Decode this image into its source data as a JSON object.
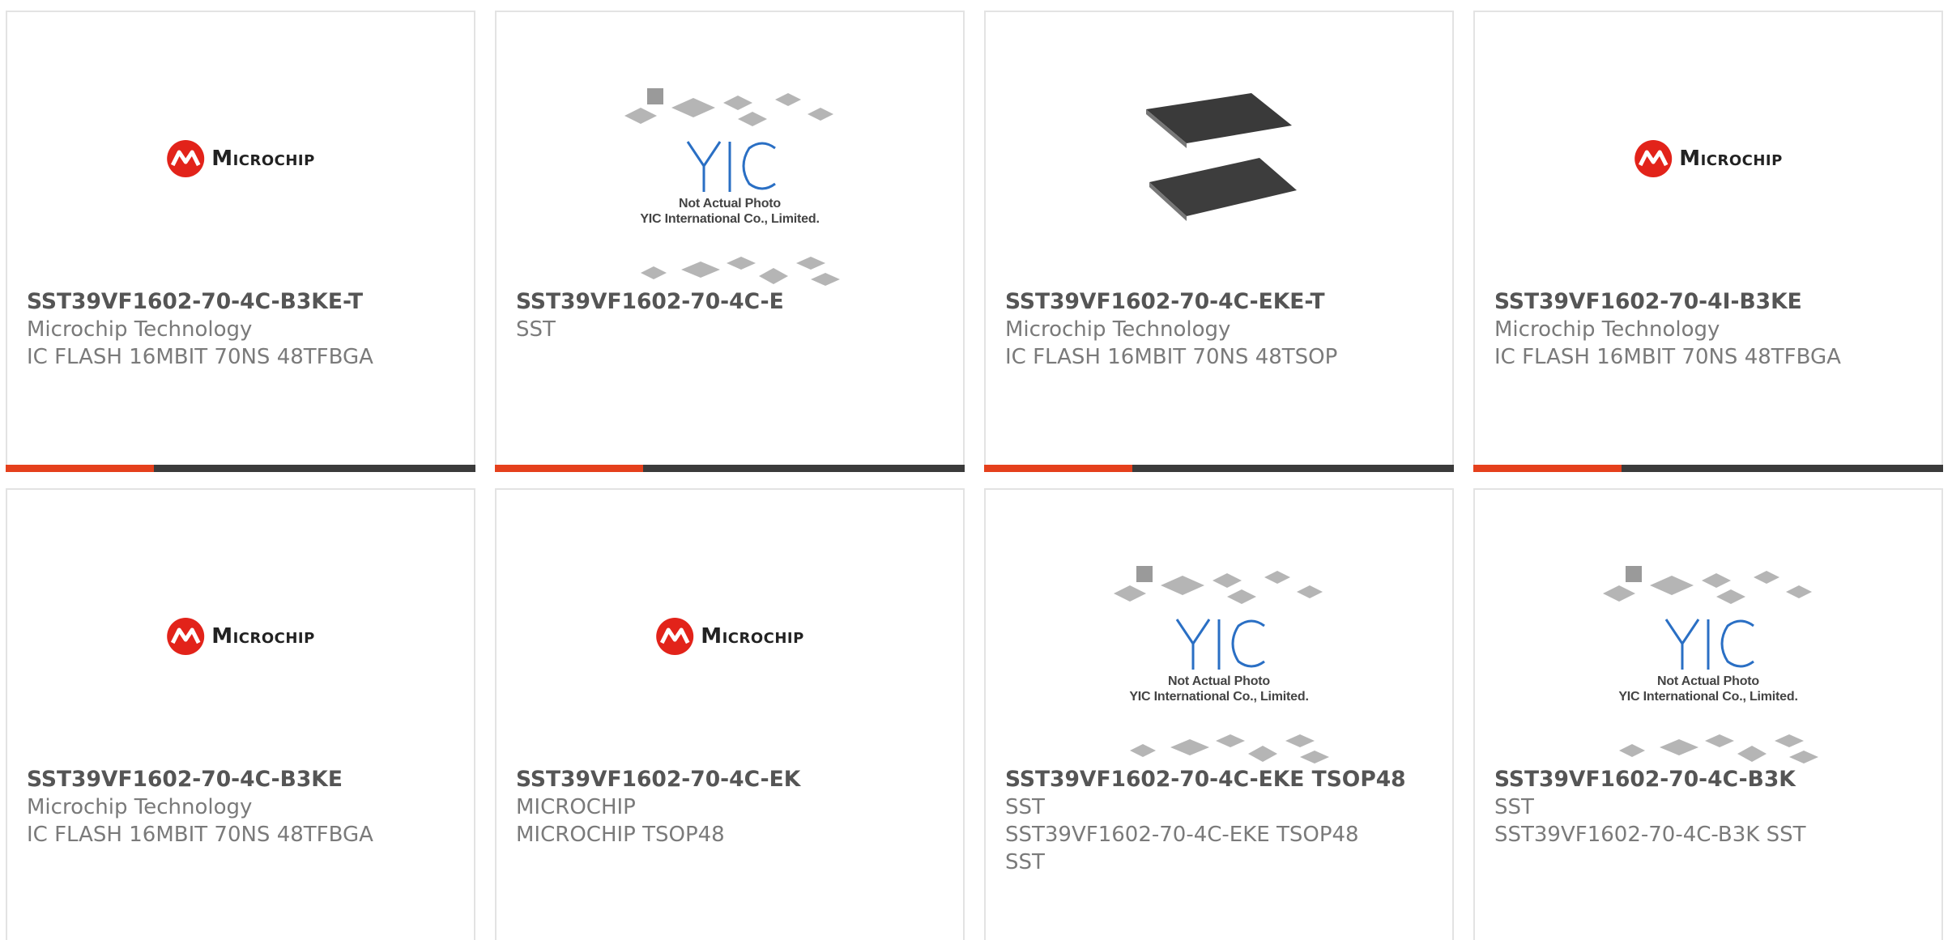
{
  "logo": {
    "word": "Microchip"
  },
  "placeholder": {
    "line1": "Not Actual Photo",
    "line2": "YIC International Co., Limited.",
    "brand": "YIC"
  },
  "colors": {
    "accent": "#e5401c",
    "bar": "#3b3b3b",
    "part": "#555555",
    "desc": "#7a7a7a",
    "border": "#e3e3e3"
  },
  "products": [
    {
      "image": "microchip-logo",
      "part": "SST39VF1602-70-4C-B3KE-T",
      "lines": [
        "Microchip Technology",
        "IC FLASH 16MBIT 70NS 48TFBGA"
      ]
    },
    {
      "image": "yic-placeholder",
      "part": "SST39VF1602-70-4C-E",
      "lines": [
        "SST"
      ]
    },
    {
      "image": "chip-photo",
      "part": "SST39VF1602-70-4C-EKE-T",
      "lines": [
        "Microchip Technology",
        "IC FLASH 16MBIT 70NS 48TSOP"
      ]
    },
    {
      "image": "microchip-logo",
      "part": "SST39VF1602-70-4I-B3KE",
      "lines": [
        "Microchip Technology",
        "IC FLASH 16MBIT 70NS 48TFBGA"
      ]
    },
    {
      "image": "microchip-logo",
      "part": "SST39VF1602-70-4C-B3KE",
      "lines": [
        "Microchip Technology",
        "IC FLASH 16MBIT 70NS 48TFBGA"
      ]
    },
    {
      "image": "microchip-logo",
      "part": "SST39VF1602-70-4C-EK",
      "lines": [
        "MICROCHIP",
        "MICROCHIP TSOP48"
      ]
    },
    {
      "image": "yic-placeholder",
      "part": "SST39VF1602-70-4C-EKE TSOP48",
      "lines": [
        "SST",
        "SST39VF1602-70-4C-EKE TSOP48",
        "SST"
      ]
    },
    {
      "image": "yic-placeholder",
      "part": "SST39VF1602-70-4C-B3K",
      "lines": [
        "SST",
        "SST39VF1602-70-4C-B3K SST"
      ]
    }
  ]
}
